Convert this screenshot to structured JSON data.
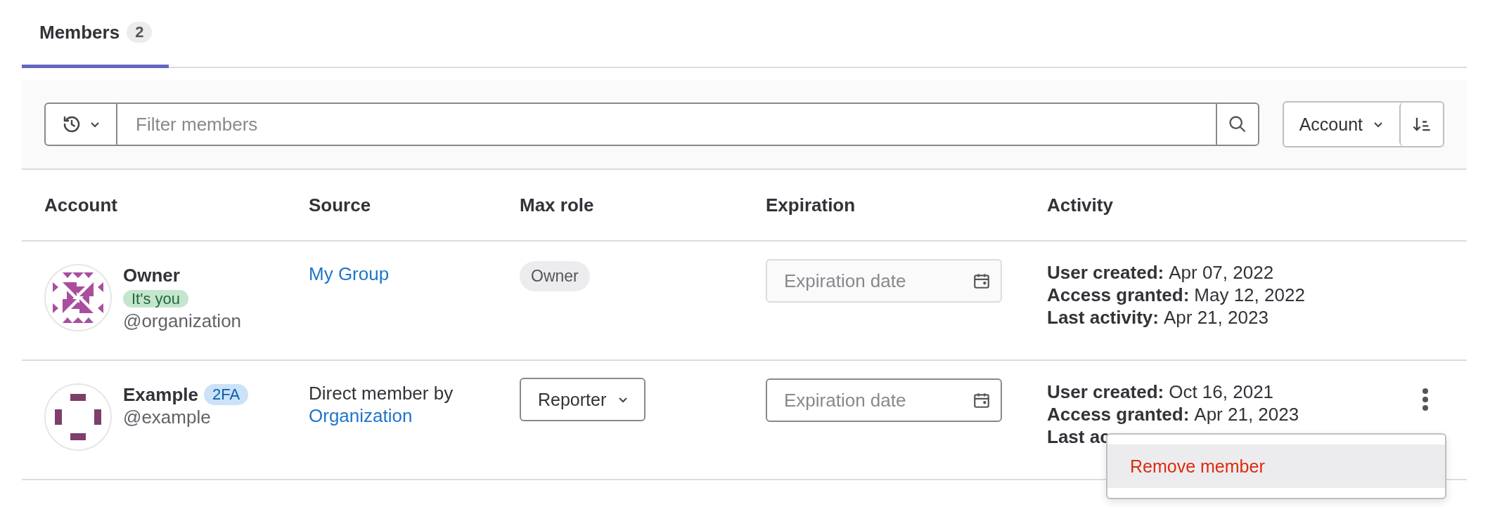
{
  "tabs": [
    {
      "label": "Members",
      "count": "2",
      "selected": true
    }
  ],
  "filter": {
    "placeholder": "Filter members"
  },
  "sort": {
    "label": "Account"
  },
  "table": {
    "columns": [
      "Account",
      "Source",
      "Max role",
      "Expiration",
      "Activity"
    ],
    "rows": [
      {
        "name": "Owner",
        "badge": {
          "label": "It's you",
          "color": "#c3e6cd"
        },
        "username": "@organization",
        "source": {
          "link": "My Group"
        },
        "role": {
          "kind": "badge",
          "label": "Owner"
        },
        "expiration": {
          "placeholder": "Expiration date",
          "disabled": true
        },
        "activity": [
          {
            "label": "User created:",
            "value": "Apr 07, 2022"
          },
          {
            "label": "Access granted:",
            "value": "May 12, 2022"
          },
          {
            "label": "Last activity:",
            "value": "Apr 21, 2023"
          }
        ],
        "actions": false
      },
      {
        "name": "Example",
        "badge": {
          "label": "2FA",
          "color": "#cbe2f9"
        },
        "username": "@example",
        "source": {
          "text": "Direct member by",
          "link": "Organization"
        },
        "role": {
          "kind": "dropdown",
          "label": "Reporter"
        },
        "expiration": {
          "placeholder": "Expiration date",
          "disabled": false
        },
        "activity": [
          {
            "label": "User created:",
            "value": "Oct 16, 2021"
          },
          {
            "label": "Access granted:",
            "value": "Apr 21, 2023"
          },
          {
            "label": "Last ac"
          }
        ],
        "actions": true
      }
    ]
  },
  "menu": {
    "items": [
      {
        "label": "Remove member",
        "selected": true
      }
    ]
  }
}
